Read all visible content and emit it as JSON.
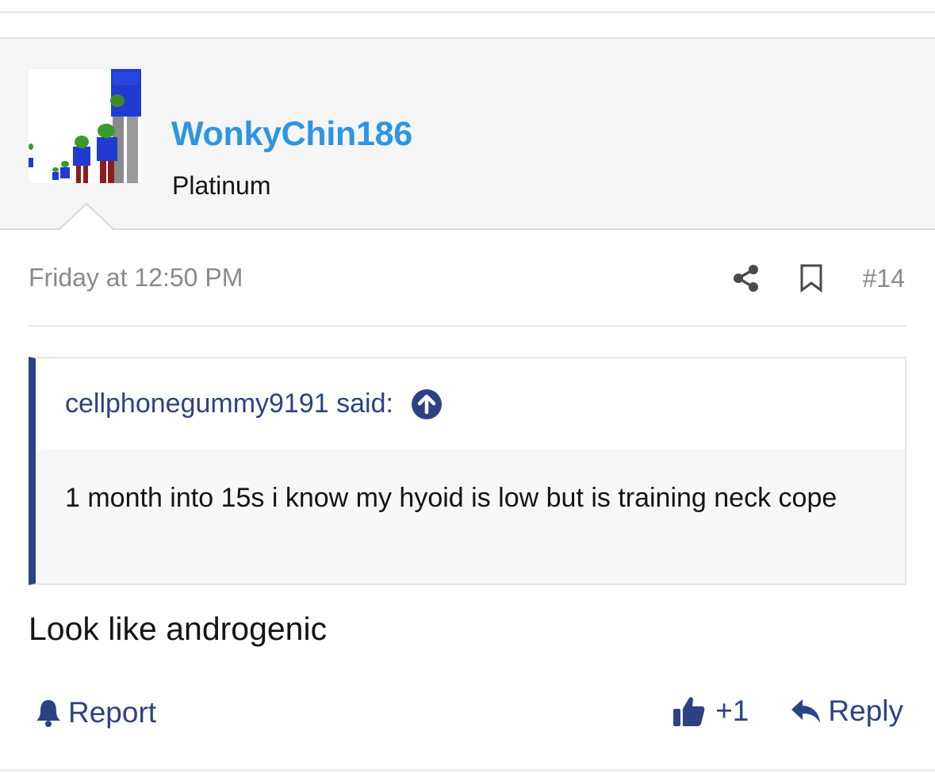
{
  "header": {
    "username": "WonkyChin186",
    "user_title": "Platinum",
    "avatar_icon": "pepe-lineup-avatar"
  },
  "meta": {
    "date": "Friday at 12:50 PM",
    "post_number": "#14",
    "share_icon": "share-icon",
    "bookmark_icon": "bookmark-icon"
  },
  "quote": {
    "author_line": "cellphonegummy9191 said:",
    "body": "1 month into 15s i know my hyoid is low but is training neck cope",
    "jump_icon": "arrow-up-circle-icon"
  },
  "post": {
    "body": "Look like androgenic"
  },
  "footer": {
    "report_label": "Report",
    "like_count": "+1",
    "reply_label": "Reply"
  },
  "colors": {
    "username": "#2b96e3",
    "accent": "#2c4283",
    "header_bg": "#f5f5f5",
    "quote_bg": "#f7f7f7"
  }
}
